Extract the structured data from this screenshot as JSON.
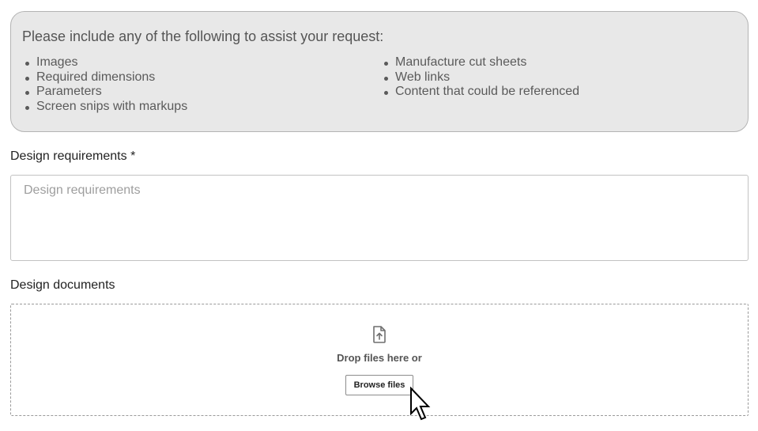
{
  "info": {
    "title": "Please include any of the following to assist your request:",
    "left_items": [
      "Images",
      "Required dimensions",
      "Parameters",
      "Screen snips with markups"
    ],
    "right_items": [
      "Manufacture cut sheets",
      "Web links",
      "Content that could be referenced"
    ]
  },
  "requirements": {
    "label": "Design requirements *",
    "placeholder": "Design requirements",
    "value": ""
  },
  "documents": {
    "label": "Design documents",
    "icon": "file-upload-icon",
    "drop_text": "Drop files here or",
    "browse_label": "Browse files"
  },
  "cursor": {
    "icon": "mouse-pointer-icon"
  }
}
